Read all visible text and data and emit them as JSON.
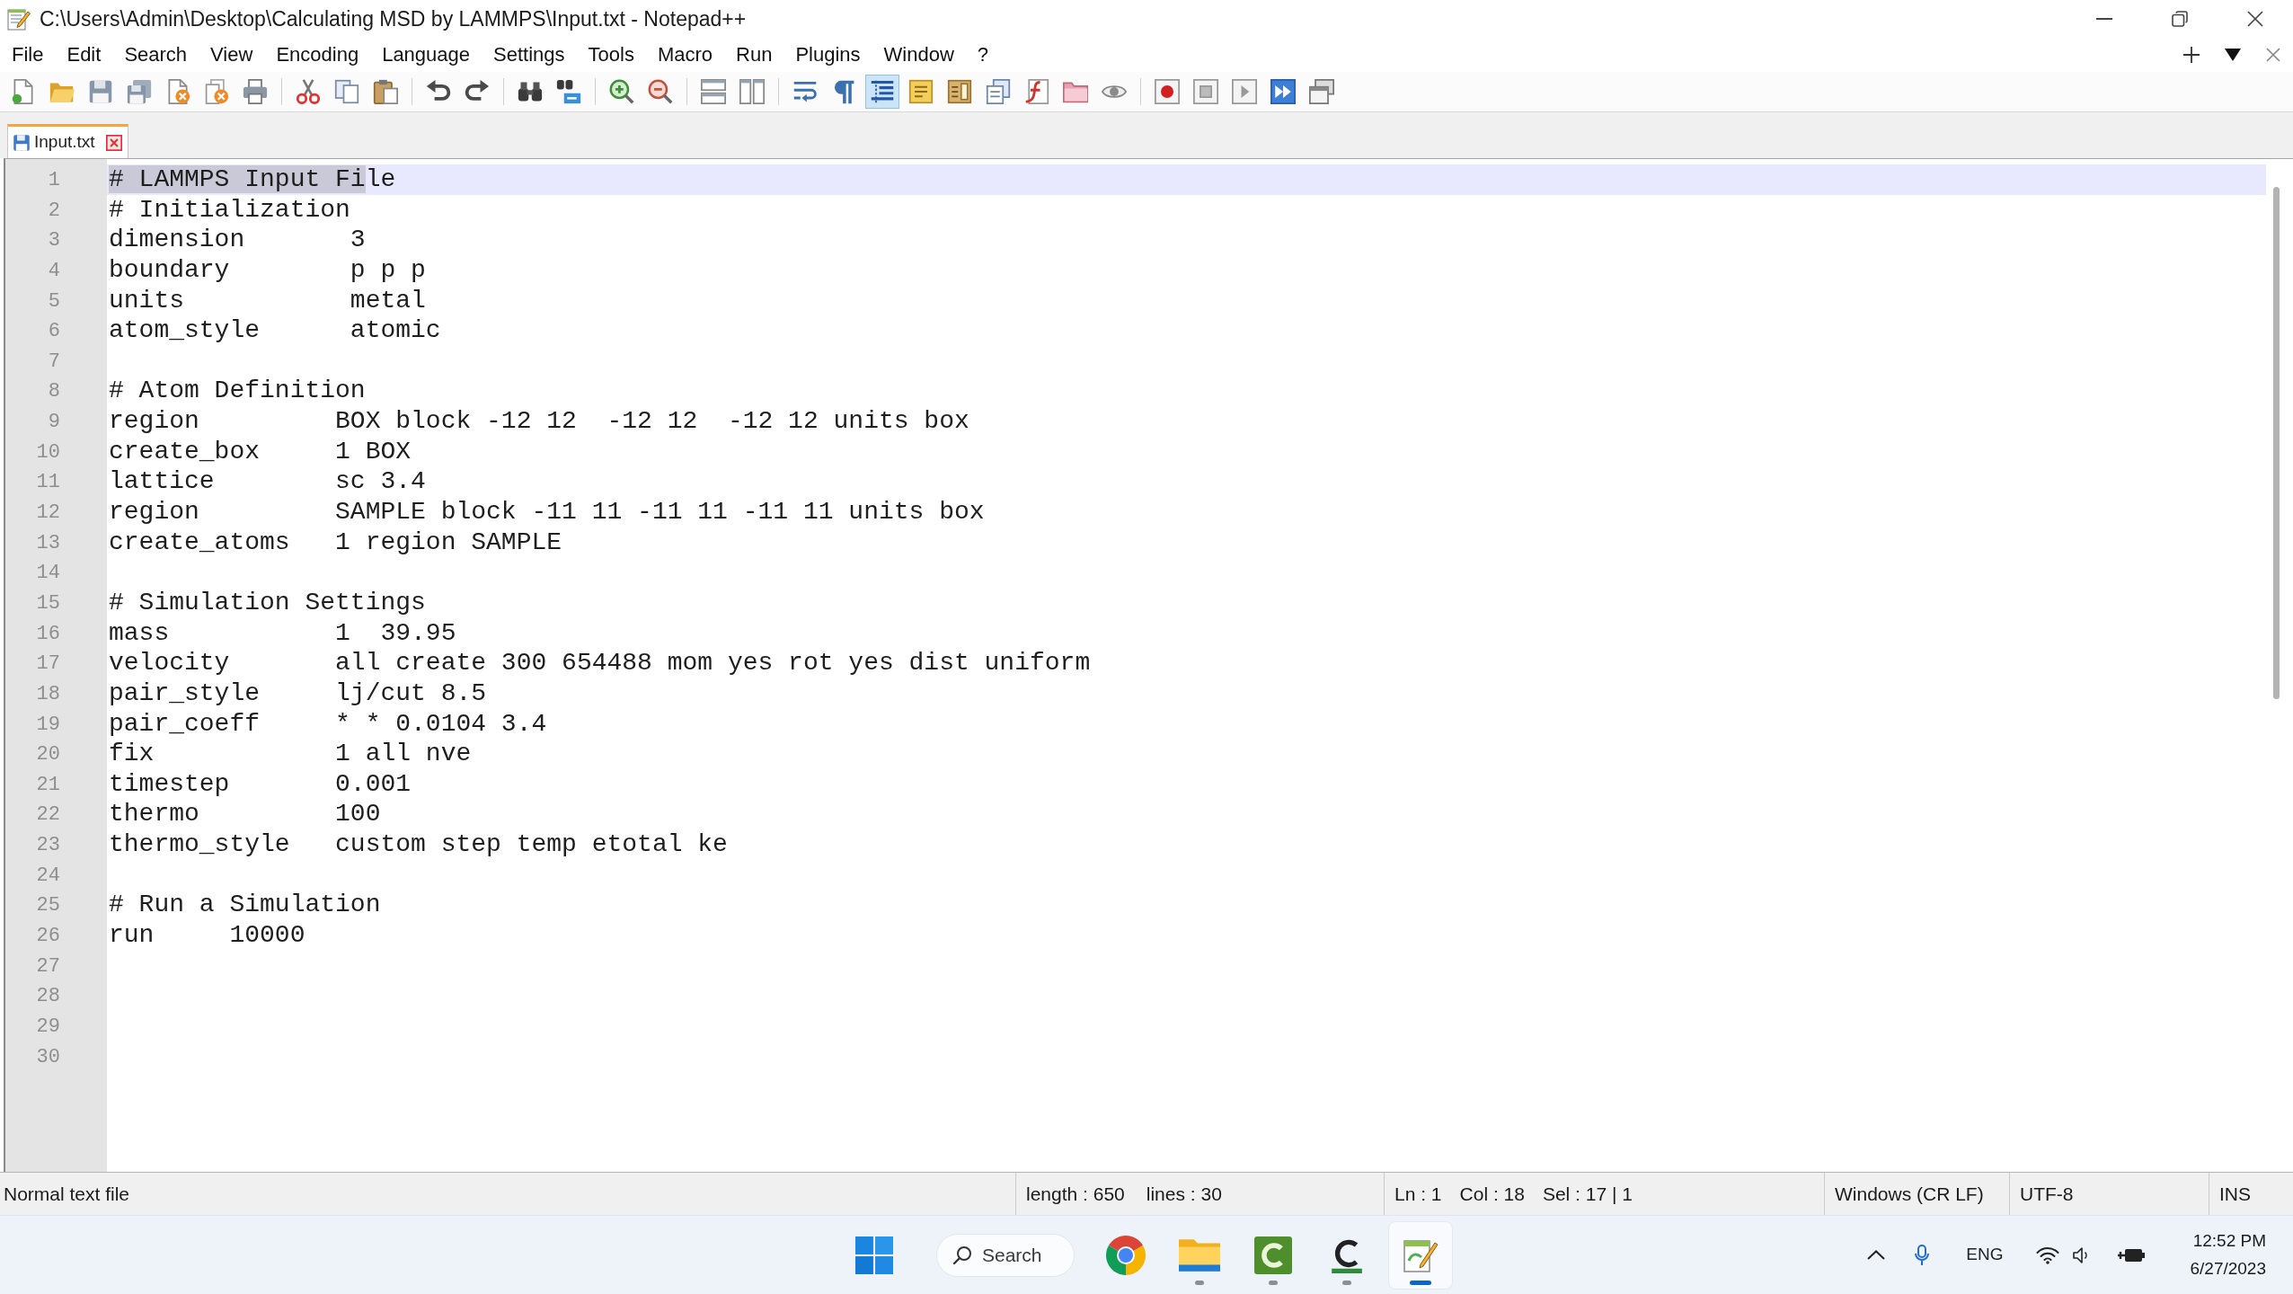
{
  "window": {
    "title": "C:\\Users\\Admin\\Desktop\\Calculating MSD by LAMMPS\\Input.txt - Notepad++"
  },
  "menu": [
    "File",
    "Edit",
    "Search",
    "View",
    "Encoding",
    "Language",
    "Settings",
    "Tools",
    "Macro",
    "Run",
    "Plugins",
    "Window",
    "?"
  ],
  "toolbar": {
    "groups": [
      {
        "buttons": [
          {
            "pressed": false
          },
          {
            "pressed": false
          },
          {
            "pressed": false
          },
          {
            "pressed": false
          },
          {
            "pressed": false
          },
          {
            "pressed": false
          },
          {
            "pressed": false
          }
        ]
      },
      {
        "buttons": [
          {
            "pressed": false
          },
          {
            "pressed": false
          },
          {
            "pressed": false
          }
        ]
      },
      {
        "buttons": [
          {
            "pressed": false
          },
          {
            "pressed": false
          }
        ]
      },
      {
        "buttons": [
          {
            "pressed": false
          },
          {
            "pressed": false
          }
        ]
      },
      {
        "buttons": [
          {
            "pressed": false
          },
          {
            "pressed": false
          }
        ]
      },
      {
        "buttons": [
          {
            "pressed": false
          },
          {
            "pressed": false
          }
        ]
      },
      {
        "buttons": [
          {
            "pressed": false
          },
          {
            "pressed": false
          },
          {
            "pressed": true
          },
          {
            "pressed": false
          },
          {
            "pressed": false
          },
          {
            "pressed": false
          },
          {
            "pressed": false
          },
          {
            "pressed": false
          },
          {
            "pressed": false
          }
        ]
      },
      {
        "buttons": [
          {
            "pressed": false
          },
          {
            "pressed": false
          },
          {
            "pressed": false
          },
          {
            "pressed": false
          },
          {
            "pressed": false
          }
        ]
      }
    ]
  },
  "tabs": [
    {
      "label": "Input.txt",
      "selected": true
    }
  ],
  "editor": {
    "lines": [
      {
        "number": "1",
        "current": true,
        "selected_text": "# LAMMPS Input Fi",
        "text": "le"
      },
      {
        "number": "2",
        "current": false,
        "text": "# Initialization"
      },
      {
        "number": "3",
        "current": false,
        "text": "dimension       3"
      },
      {
        "number": "4",
        "current": false,
        "text": "boundary        p p p"
      },
      {
        "number": "5",
        "current": false,
        "text": "units           metal"
      },
      {
        "number": "6",
        "current": false,
        "text": "atom_style      atomic"
      },
      {
        "number": "7",
        "current": false
      },
      {
        "number": "8",
        "current": false,
        "text": "# Atom Definition"
      },
      {
        "number": "9",
        "current": false,
        "text": "region         BOX block -12 12  -12 12  -12 12 units box"
      },
      {
        "number": "10",
        "current": false,
        "text": "create_box     1 BOX"
      },
      {
        "number": "11",
        "current": false,
        "text": "lattice        sc 3.4"
      },
      {
        "number": "12",
        "current": false,
        "text": "region         SAMPLE block -11 11 -11 11 -11 11 units box"
      },
      {
        "number": "13",
        "current": false,
        "text": "create_atoms   1 region SAMPLE"
      },
      {
        "number": "14",
        "current": false
      },
      {
        "number": "15",
        "current": false,
        "text": "# Simulation Settings"
      },
      {
        "number": "16",
        "current": false,
        "text": "mass           1  39.95"
      },
      {
        "number": "17",
        "current": false,
        "text": "velocity       all create 300 654488 mom yes rot yes dist uniform"
      },
      {
        "number": "18",
        "current": false,
        "text": "pair_style     lj/cut 8.5"
      },
      {
        "number": "19",
        "current": false,
        "text": "pair_coeff     * * 0.0104 3.4"
      },
      {
        "number": "20",
        "current": false,
        "text": "fix            1 all nve"
      },
      {
        "number": "21",
        "current": false,
        "text": "timestep       0.001"
      },
      {
        "number": "22",
        "current": false,
        "text": "thermo         100"
      },
      {
        "number": "23",
        "current": false,
        "text": "thermo_style   custom step temp etotal ke"
      },
      {
        "number": "24",
        "current": false
      },
      {
        "number": "25",
        "current": false,
        "text": "# Run a Simulation"
      },
      {
        "number": "26",
        "current": false,
        "text": "run     10000"
      },
      {
        "number": "27",
        "current": false
      },
      {
        "number": "28",
        "current": false
      },
      {
        "number": "29",
        "current": false
      },
      {
        "number": "30",
        "current": false
      }
    ]
  },
  "status_bar": {
    "file_type": "Normal text file",
    "length": "length : 650",
    "lines": "lines : 30",
    "line": "Ln : 1",
    "column": "Col : 18",
    "selection": "Sel : 17 | 1",
    "line_ending": "Windows (CR LF)",
    "encoding": "UTF-8",
    "insert_mode": "INS"
  },
  "taskbar": {
    "search": {
      "placeholder": "Search"
    },
    "apps": [
      {
        "running": false,
        "active": false
      },
      {
        "running": true,
        "active": false
      },
      {
        "running": true,
        "active": false
      },
      {
        "running": true,
        "active": false
      },
      {
        "running": true,
        "active": true
      }
    ],
    "tray": {
      "language": "ENG",
      "time": "12:52 PM",
      "date": "6/27/2023"
    }
  }
}
